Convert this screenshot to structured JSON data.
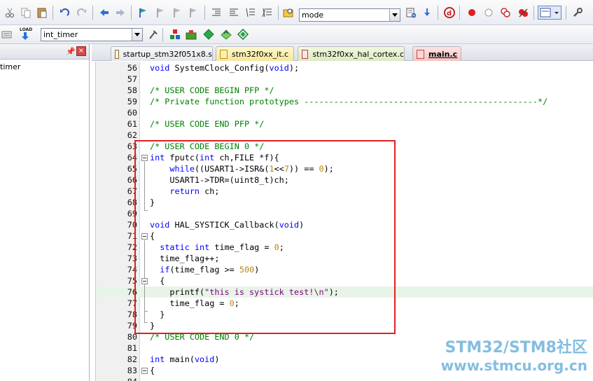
{
  "toolbar": {
    "mode_combo_value": "mode",
    "target_combo_value": "int_timer",
    "load_button_label": "LOAD"
  },
  "left_panel": {
    "pin_glyph": "📌",
    "close_glyph": "×",
    "tree_item_label": "timer"
  },
  "tabs": [
    {
      "label": "startup_stm32f051x8.s"
    },
    {
      "label": "stm32f0xx_it.c"
    },
    {
      "label": "stm32f0xx_hal_cortex.c"
    },
    {
      "label": "main.c"
    }
  ],
  "editor": {
    "lines": [
      {
        "n": "56",
        "tokens": [
          {
            "t": "void",
            "c": "kw"
          },
          {
            "t": " SystemClock_Config("
          },
          {
            "t": "void",
            "c": "kw"
          },
          {
            "t": ");"
          }
        ]
      },
      {
        "n": "57",
        "tokens": []
      },
      {
        "n": "58",
        "tokens": [
          {
            "t": "/* USER CODE BEGIN PFP */",
            "c": "cm"
          }
        ]
      },
      {
        "n": "59",
        "tokens": [
          {
            "t": "/* Private function prototypes -----------------------------------------------*/",
            "c": "cm"
          }
        ]
      },
      {
        "n": "60",
        "tokens": []
      },
      {
        "n": "61",
        "tokens": [
          {
            "t": "/* USER CODE END PFP */",
            "c": "cm"
          }
        ]
      },
      {
        "n": "62",
        "tokens": []
      },
      {
        "n": "63",
        "tokens": [
          {
            "t": "/* USER CODE BEGIN 0 */",
            "c": "cm"
          }
        ]
      },
      {
        "n": "64",
        "tokens": [
          {
            "t": "int",
            "c": "kw"
          },
          {
            "t": " fputc("
          },
          {
            "t": "int",
            "c": "kw"
          },
          {
            "t": " ch,FILE *f){"
          }
        ]
      },
      {
        "n": "65",
        "tokens": [
          {
            "t": "    "
          },
          {
            "t": "while",
            "c": "kw"
          },
          {
            "t": "((USART1->ISR&("
          },
          {
            "t": "1",
            "c": "nm"
          },
          {
            "t": "<<"
          },
          {
            "t": "7",
            "c": "nm"
          },
          {
            "t": ")) == "
          },
          {
            "t": "0",
            "c": "nm"
          },
          {
            "t": ");"
          }
        ]
      },
      {
        "n": "66",
        "tokens": [
          {
            "t": "    USART1->TDR=(uint8_t)ch;"
          }
        ]
      },
      {
        "n": "67",
        "tokens": [
          {
            "t": "    "
          },
          {
            "t": "return",
            "c": "kw"
          },
          {
            "t": " ch;"
          }
        ]
      },
      {
        "n": "68",
        "tokens": [
          {
            "t": "}"
          }
        ]
      },
      {
        "n": "69",
        "tokens": []
      },
      {
        "n": "70",
        "tokens": [
          {
            "t": "void",
            "c": "kw"
          },
          {
            "t": " HAL_SYSTICK_Callback("
          },
          {
            "t": "void",
            "c": "kw"
          },
          {
            "t": ")"
          }
        ]
      },
      {
        "n": "71",
        "tokens": [
          {
            "t": "{"
          }
        ]
      },
      {
        "n": "72",
        "tokens": [
          {
            "t": "  "
          },
          {
            "t": "static",
            "c": "kw"
          },
          {
            "t": " "
          },
          {
            "t": "int",
            "c": "kw"
          },
          {
            "t": " time_flag = "
          },
          {
            "t": "0",
            "c": "nm"
          },
          {
            "t": ";"
          }
        ]
      },
      {
        "n": "73",
        "tokens": [
          {
            "t": "  time_flag++;"
          }
        ]
      },
      {
        "n": "74",
        "tokens": [
          {
            "t": "  "
          },
          {
            "t": "if",
            "c": "kw"
          },
          {
            "t": "(time_flag >= "
          },
          {
            "t": "500",
            "c": "nm"
          },
          {
            "t": ")"
          }
        ]
      },
      {
        "n": "75",
        "tokens": [
          {
            "t": "  {"
          }
        ]
      },
      {
        "n": "76",
        "tokens": [
          {
            "t": "    printf("
          },
          {
            "t": "\"this is systick test!\\n\"",
            "c": "st"
          },
          {
            "t": ");"
          }
        ],
        "hl": true
      },
      {
        "n": "77",
        "tokens": [
          {
            "t": "    time_flag = "
          },
          {
            "t": "0",
            "c": "nm"
          },
          {
            "t": ";"
          }
        ]
      },
      {
        "n": "78",
        "tokens": [
          {
            "t": "  }"
          }
        ]
      },
      {
        "n": "79",
        "tokens": [
          {
            "t": "}"
          }
        ]
      },
      {
        "n": "80",
        "tokens": [
          {
            "t": "/* USER CODE END 0 */",
            "c": "cm"
          }
        ]
      },
      {
        "n": "81",
        "tokens": []
      },
      {
        "n": "82",
        "tokens": [
          {
            "t": "int",
            "c": "kw"
          },
          {
            "t": " main("
          },
          {
            "t": "void",
            "c": "kw"
          },
          {
            "t": ")"
          }
        ]
      },
      {
        "n": "83",
        "tokens": [
          {
            "t": "{"
          }
        ]
      },
      {
        "n": "84",
        "tokens": []
      }
    ]
  },
  "watermark": {
    "line1": "STM32/STM8社区",
    "line2": "www.stmcu.org.cn"
  },
  "colors": {
    "keyword": "#0000ff",
    "comment": "#008000",
    "number": "#b8860b",
    "string": "#800080",
    "annotation_box": "#e02020",
    "active_tab": "#fbd3d3",
    "watermark": "#5aa9d8"
  }
}
